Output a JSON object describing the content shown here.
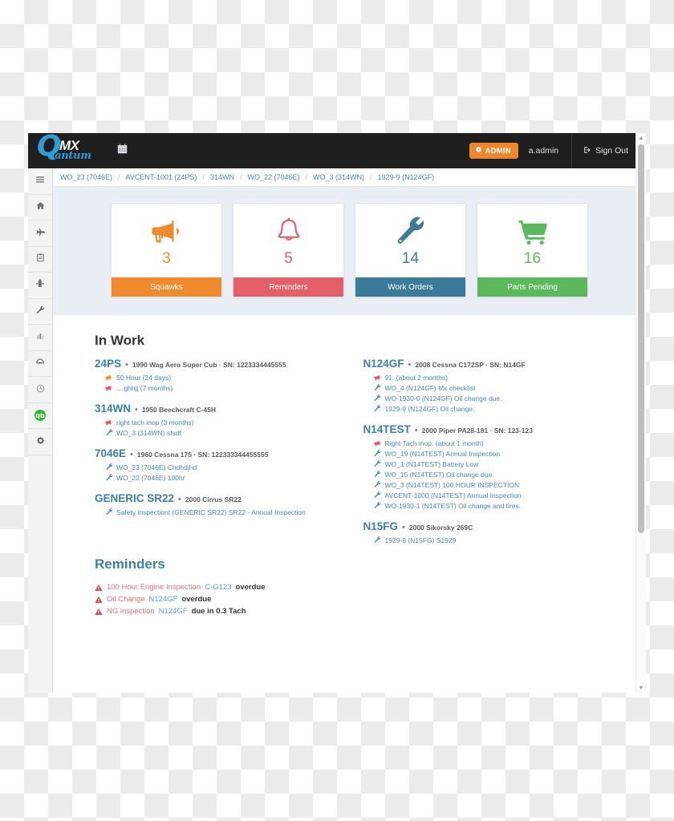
{
  "brand": {
    "q": "Q",
    "mx": "MX",
    "uantum": "uantum",
    "calendar_icon": "calendar-icon"
  },
  "navbar": {
    "admin_label": "ADMIN",
    "admin_icon": "gear-icon",
    "username": "a.admin",
    "signout_label": "Sign Out",
    "signout_icon": "sign-out-icon"
  },
  "sidebar": {
    "items": [
      {
        "icon": "hamburger-menu-icon",
        "name": "sidebar-item-menu"
      },
      {
        "icon": "home-icon",
        "name": "sidebar-item-home"
      },
      {
        "icon": "airplane-icon",
        "name": "sidebar-item-aircraft"
      },
      {
        "icon": "clipboard-icon",
        "name": "sidebar-item-logbook"
      },
      {
        "icon": "tools-icon",
        "name": "sidebar-item-maintenance"
      },
      {
        "icon": "wrench-icon",
        "name": "sidebar-item-work-orders"
      },
      {
        "icon": "bar-chart-icon",
        "name": "sidebar-item-reports"
      },
      {
        "icon": "gauge-icon",
        "name": "sidebar-item-dashboard"
      },
      {
        "icon": "clock-icon",
        "name": "sidebar-item-time"
      },
      {
        "icon": "quickbooks-icon",
        "name": "sidebar-item-quickbooks",
        "badge_text": "qb"
      },
      {
        "icon": "gear-icon",
        "name": "sidebar-item-settings"
      }
    ]
  },
  "breadcrumb": {
    "separator": "/",
    "items": [
      "WO_23 (7046E)",
      "AVCENT-1001 (24PS)",
      "314WN",
      "WO_22 (7046E)",
      "WO_3 (314WN)",
      "1929-9 (N124GF)"
    ]
  },
  "stat_cards": [
    {
      "icon": "megaphone-icon",
      "count": "3",
      "label": "Squawks",
      "color": "#ef8b2c"
    },
    {
      "icon": "bell-icon",
      "count": "5",
      "label": "Reminders",
      "color": "#e45f6a"
    },
    {
      "icon": "wrench-icon",
      "count": "14",
      "label": "Work Orders",
      "color": "#3b7b99"
    },
    {
      "icon": "cart-icon",
      "count": "16",
      "label": "Parts Pending",
      "color": "#5cb85c"
    }
  ],
  "in_work": {
    "title": "In Work",
    "left_column": [
      {
        "registration": "24PS",
        "separator": "•",
        "description": "1990 Wag Aero Super Cub · SN: 1223334445555",
        "items": [
          {
            "icon": "megaphone-icon",
            "icon_color": "#ef8b2c",
            "text": "50 Hour (24 days)"
          },
          {
            "icon": "megaphone-icon",
            "icon_color": "#e8505c",
            "text": "....ghhjj (7 months)"
          }
        ]
      },
      {
        "registration": "314WN",
        "separator": "•",
        "description": "1950 Beechcraft C-45H",
        "items": [
          {
            "icon": "megaphone-icon",
            "icon_color": "#e8505c",
            "text": "right tach inop (3 months)"
          },
          {
            "icon": "wrench-icon",
            "icon_color": "#4a87b5",
            "text": "WO_3 (314WN) sfsdf"
          }
        ]
      },
      {
        "registration": "7046E",
        "separator": "•",
        "description": "1960 Cessna 175 · SN: 122333344455555",
        "items": [
          {
            "icon": "wrench-icon",
            "icon_color": "#4a87b5",
            "text": "WO_23 (7046E) Chdhdjhd"
          },
          {
            "icon": "wrench-icon",
            "icon_color": "#4a87b5",
            "text": "WO_22 (7046E) 100hr"
          }
        ]
      },
      {
        "registration": "GENERIC SR22",
        "separator": "•",
        "description": "2000 Cirrus SR22",
        "items": [
          {
            "icon": "wrench-icon",
            "icon_color": "#4a87b5",
            "text": "Safety inspectiont (GENERIC SR22) SR22 - Annual Inspection"
          }
        ]
      }
    ],
    "right_column": [
      {
        "registration": "N124GF",
        "separator": "•",
        "description": "2008 Cessna C172SP · SN: N14GF",
        "items": [
          {
            "icon": "megaphone-icon",
            "icon_color": "#e8505c",
            "text": "91. (about 2 months)"
          },
          {
            "icon": "wrench-icon",
            "icon_color": "#4a87b5",
            "text": "WO_4 (N124GF) Mx checklist"
          },
          {
            "icon": "wrench-icon",
            "icon_color": "#4a87b5",
            "text": "WO-1930-0 (N124GF) Oil change due."
          },
          {
            "icon": "wrench-icon",
            "icon_color": "#4a87b5",
            "text": "1929-9 (N124GF) Oil change."
          }
        ]
      },
      {
        "registration": "N14TEST",
        "separator": "•",
        "description": "2000 Piper PA28-181 · SN: 123-123",
        "items": [
          {
            "icon": "megaphone-icon",
            "icon_color": "#e8505c",
            "text": "Right Tach inop. (about 1 month)"
          },
          {
            "icon": "wrench-icon",
            "icon_color": "#4a87b5",
            "text": "WO_19 (N14TEST) Annual Inspection"
          },
          {
            "icon": "wrench-icon",
            "icon_color": "#4a87b5",
            "text": "WO_1 (N14TEST) Battery Low"
          },
          {
            "icon": "wrench-icon",
            "icon_color": "#4a87b5",
            "text": "WO_15 (N14TEST) Oil change due."
          },
          {
            "icon": "wrench-icon",
            "icon_color": "#4a87b5",
            "text": "WO_3 (N14TEST) 100 HOUR INSPECTION"
          },
          {
            "icon": "wrench-icon",
            "icon_color": "#4a87b5",
            "text": "AVCENT-1000 (N14TEST) Annual Inspection"
          },
          {
            "icon": "wrench-icon",
            "icon_color": "#4a87b5",
            "text": "WO-1930-1 (N14TEST) Oil change and tires."
          }
        ]
      },
      {
        "registration": "N15FG",
        "separator": "•",
        "description": "2000 Sikorsky 269C",
        "items": [
          {
            "icon": "wrench-icon",
            "icon_color": "#4a87b5",
            "text": "1929-8 (N15FG) S1929"
          }
        ]
      }
    ]
  },
  "reminders": {
    "title": "Reminders",
    "items": [
      {
        "icon": "warning-triangle-icon",
        "name": "100 Hour Engine Inspection",
        "registration": "C-G123",
        "suffix": "overdue"
      },
      {
        "icon": "warning-triangle-icon",
        "name": "Oil Change",
        "registration": "N124GF",
        "suffix": "overdue"
      },
      {
        "icon": "warning-triangle-icon",
        "name": "NG inspection",
        "registration": "N124GF",
        "suffix": "due in 0.3 Tach"
      }
    ]
  },
  "scrollbar": {
    "up_arrow": "▲",
    "down_arrow": "▼"
  }
}
